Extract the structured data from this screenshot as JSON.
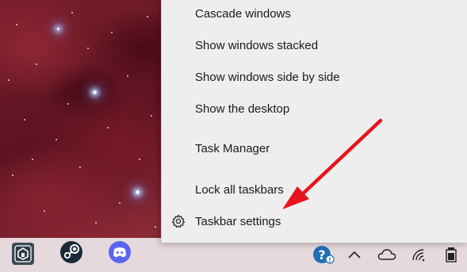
{
  "context_menu": {
    "items": [
      {
        "label": "Cascade windows"
      },
      {
        "label": "Show windows stacked"
      },
      {
        "label": "Show windows side by side"
      },
      {
        "label": "Show the desktop"
      },
      {
        "label": "Task Manager"
      },
      {
        "label": "Lock all taskbars"
      },
      {
        "label": "Taskbar settings",
        "icon": "gear-icon"
      }
    ]
  },
  "taskbar": {
    "apps": [
      {
        "name": "app-icon",
        "icon": "shield-house-icon",
        "color": "#3a4a55"
      },
      {
        "name": "steam",
        "icon": "steam-icon",
        "color": "#1b2838"
      },
      {
        "name": "discord",
        "icon": "discord-icon",
        "color": "#5865f2"
      }
    ],
    "tray": [
      {
        "icon": "help-notification-icon",
        "color": "#1f6fb5"
      },
      {
        "icon": "chevron-up-icon"
      },
      {
        "icon": "onedrive-cloud-icon"
      },
      {
        "icon": "wifi-icon"
      },
      {
        "icon": "battery-icon"
      }
    ]
  },
  "annotation": {
    "arrow_color": "#e8141c"
  }
}
